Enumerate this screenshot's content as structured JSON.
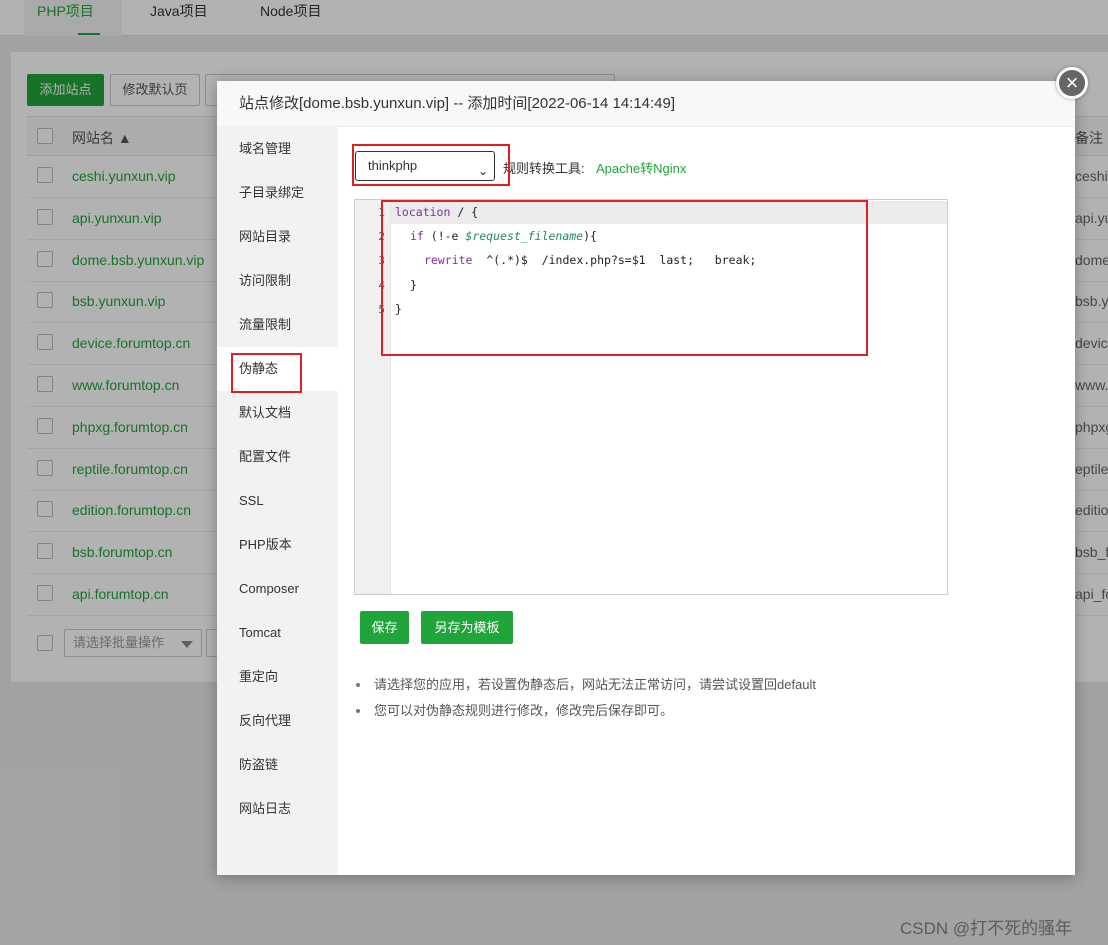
{
  "tabs": [
    "PHP项目",
    "Java项目",
    "Node项目"
  ],
  "toolbar": {
    "add_site": "添加站点",
    "modify_default": "修改默认页"
  },
  "table": {
    "col_name": "网站名 ▲",
    "col_note": "备注",
    "rows": [
      {
        "name": "ceshi.yunxun.vip",
        "note": "ceshi.y"
      },
      {
        "name": "api.yunxun.vip",
        "note": "api.yu"
      },
      {
        "name": "dome.bsb.yunxun.vip",
        "note": "dome"
      },
      {
        "name": "bsb.yunxun.vip",
        "note": "bsb.yu"
      },
      {
        "name": "device.forumtop.cn",
        "note": "device"
      },
      {
        "name": "www.forumtop.cn",
        "note": "www.f"
      },
      {
        "name": "phpxg.forumtop.cn",
        "note": "phpxg"
      },
      {
        "name": "reptile.forumtop.cn",
        "note": "eptile"
      },
      {
        "name": "edition.forumtop.cn",
        "note": "editio"
      },
      {
        "name": "bsb.forumtop.cn",
        "note": "bsb_fo"
      },
      {
        "name": "api.forumtop.cn",
        "note": "api_fo"
      }
    ]
  },
  "batch": {
    "placeholder": "请选择批量操作"
  },
  "modal": {
    "title": "站点修改[dome.bsb.yunxun.vip] -- 添加时间[2022-06-14 14:14:49]",
    "close_icon": "×",
    "menu": [
      "域名管理",
      "子目录绑定",
      "网站目录",
      "访问限制",
      "流量限制",
      "伪静态",
      "默认文档",
      "配置文件",
      "SSL",
      "PHP版本",
      "Composer",
      "Tomcat",
      "重定向",
      "反向代理",
      "防盗链",
      "网站日志"
    ],
    "active_menu": "伪静态",
    "rewrite_select": "thinkphp",
    "rule_tool_label": "规则转换工具:",
    "rule_tool_link": "Apache转Nginx",
    "line_numbers": [
      "1",
      "2",
      "3",
      "4",
      "5"
    ],
    "save_button": "保存",
    "save_template_button": "另存为模板",
    "tips": [
      "请选择您的应用，若设置伪静态后，网站无法正常访问，请尝试设置回default",
      "您可以对伪静态规则进行修改，修改完后保存即可。"
    ]
  },
  "code": {
    "l1_kw": "location",
    "l1_rest": " / {",
    "l2_kw": "if",
    "l2_a": " (!-e ",
    "l2_var": "$request_filename",
    "l2_b": "){",
    "l3_fn": "rewrite",
    "l3_rest": "  ^(.*)$  /index.php?s=$1  last;   break;",
    "l4": "}",
    "l5": "}"
  },
  "watermark": "CSDN @打不死的骚年",
  "colors": {
    "accent": "#20a53a",
    "highlight": "#e02020"
  }
}
